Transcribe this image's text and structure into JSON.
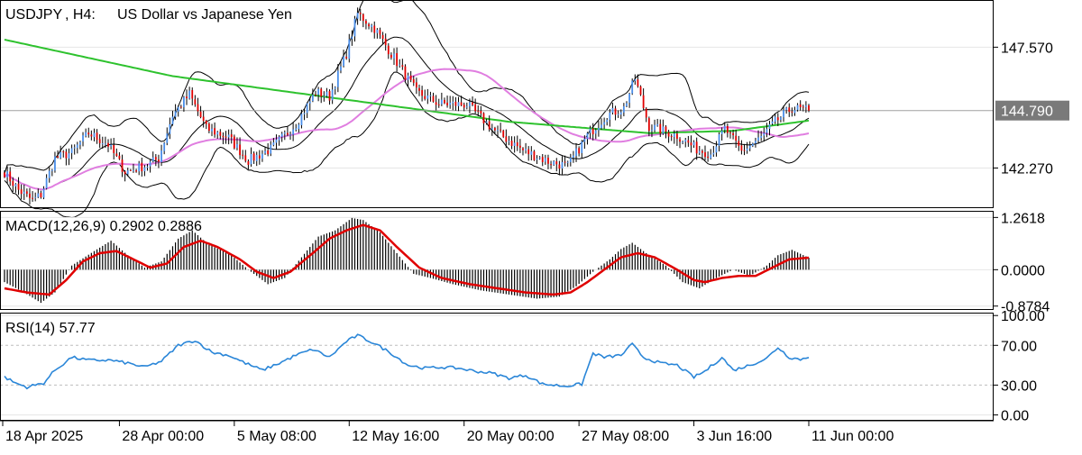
{
  "window": {
    "symbol": "USDJPY",
    "timeframe": "H4",
    "description": "US Dollar vs Japanese Yen"
  },
  "colors": {
    "background": "#ffffff",
    "grid": "#e6e6e6",
    "bull_candle": "#4b8ee8",
    "bear_candle": "#e00000",
    "bollinger": "#000000",
    "ma_fast": "#e07ee0",
    "ma_slow": "#2ec22e",
    "macd_histogram": "#000000",
    "macd_signal": "#e00000",
    "rsi_line": "#2a86d8",
    "price_line": "#a0a0a0",
    "current_price_label_bg": "#7a7a7a"
  },
  "chart_data": [
    {
      "type": "candlestick",
      "panel": "price",
      "title": "USDJPY, H4:  US Dollar vs Japanese Yen",
      "current_price": 144.79,
      "current_price_label": "144.790",
      "y_ticks": [
        {
          "value": 147.57,
          "label": "147.570"
        },
        {
          "value": 142.27,
          "label": "142.270"
        }
      ],
      "ylim": [
        140.55,
        149.6
      ],
      "x_ticks": [
        "18 Apr 2025",
        "28 Apr 00:00",
        "5 May 08:00",
        "12 May 16:00",
        "20 May 00:00",
        "27 May 08:00",
        "3 Jun 16:00",
        "11 Jun 00:00"
      ],
      "overlays": [
        "Bollinger Bands",
        "Moving Average (magenta)",
        "Moving Average (green)"
      ],
      "close_anchors": [
        [
          0,
          142.1
        ],
        [
          5,
          141.3
        ],
        [
          10,
          140.85
        ],
        [
          13,
          141.1
        ],
        [
          18,
          142.7
        ],
        [
          24,
          142.95
        ],
        [
          30,
          143.8
        ],
        [
          37,
          143.3
        ],
        [
          43,
          142.1
        ],
        [
          51,
          142.4
        ],
        [
          55,
          142.7
        ],
        [
          60,
          144.6
        ],
        [
          66,
          145.5
        ],
        [
          72,
          144.0
        ],
        [
          80,
          143.6
        ],
        [
          87,
          142.6
        ],
        [
          95,
          143.1
        ],
        [
          104,
          144.2
        ],
        [
          111,
          145.6
        ],
        [
          116,
          145.4
        ],
        [
          122,
          147.3
        ],
        [
          126,
          149.05
        ],
        [
          132,
          148.4
        ],
        [
          139,
          147.1
        ],
        [
          147,
          145.6
        ],
        [
          155,
          145.1
        ],
        [
          165,
          145.05
        ],
        [
          175,
          143.9
        ],
        [
          185,
          143.05
        ],
        [
          194,
          142.55
        ],
        [
          201,
          142.35
        ],
        [
          208,
          143.7
        ],
        [
          215,
          144.6
        ],
        [
          221,
          144.9
        ],
        [
          225,
          146.2
        ],
        [
          230,
          144.1
        ],
        [
          240,
          143.7
        ],
        [
          247,
          143.1
        ],
        [
          252,
          142.9
        ],
        [
          257,
          144.0
        ],
        [
          263,
          143.0
        ],
        [
          270,
          143.6
        ],
        [
          275,
          144.3
        ],
        [
          281,
          144.9
        ],
        [
          287,
          144.79
        ]
      ]
    },
    {
      "type": "line",
      "panel": "macd",
      "title": "MACD(12,26,9) 0.2902 0.2886",
      "series": [
        {
          "name": "MACD",
          "style": "histogram",
          "anchors": [
            [
              0,
              -0.3
            ],
            [
              7,
              -0.55
            ],
            [
              13,
              -0.8
            ],
            [
              18,
              -0.55
            ],
            [
              24,
              0.1
            ],
            [
              32,
              0.45
            ],
            [
              38,
              0.7
            ],
            [
              44,
              0.35
            ],
            [
              50,
              0.05
            ],
            [
              56,
              0.2
            ],
            [
              62,
              0.75
            ],
            [
              67,
              0.95
            ],
            [
              73,
              0.6
            ],
            [
              80,
              0.4
            ],
            [
              88,
              -0.05
            ],
            [
              94,
              -0.35
            ],
            [
              100,
              -0.2
            ],
            [
              106,
              0.3
            ],
            [
              112,
              0.8
            ],
            [
              118,
              0.95
            ],
            [
              124,
              1.25
            ],
            [
              128,
              1.2
            ],
            [
              134,
              0.9
            ],
            [
              140,
              0.4
            ],
            [
              146,
              -0.1
            ],
            [
              152,
              -0.2
            ],
            [
              160,
              -0.35
            ],
            [
              170,
              -0.5
            ],
            [
              180,
              -0.6
            ],
            [
              190,
              -0.7
            ],
            [
              198,
              -0.65
            ],
            [
              204,
              -0.4
            ],
            [
              210,
              -0.05
            ],
            [
              216,
              0.25
            ],
            [
              220,
              0.5
            ],
            [
              224,
              0.65
            ],
            [
              230,
              0.35
            ],
            [
              236,
              0.1
            ],
            [
              242,
              -0.3
            ],
            [
              248,
              -0.45
            ],
            [
              254,
              -0.2
            ],
            [
              260,
              0.0
            ],
            [
              266,
              -0.15
            ],
            [
              272,
              0.1
            ],
            [
              276,
              0.35
            ],
            [
              281,
              0.48
            ],
            [
              287,
              0.29
            ]
          ]
        },
        {
          "name": "Signal",
          "style": "line",
          "anchors": [
            [
              0,
              -0.45
            ],
            [
              8,
              -0.55
            ],
            [
              16,
              -0.6
            ],
            [
              22,
              -0.25
            ],
            [
              28,
              0.2
            ],
            [
              34,
              0.4
            ],
            [
              40,
              0.45
            ],
            [
              46,
              0.25
            ],
            [
              52,
              0.05
            ],
            [
              58,
              0.15
            ],
            [
              64,
              0.55
            ],
            [
              70,
              0.7
            ],
            [
              76,
              0.55
            ],
            [
              84,
              0.25
            ],
            [
              90,
              -0.05
            ],
            [
              96,
              -0.2
            ],
            [
              102,
              -0.05
            ],
            [
              110,
              0.4
            ],
            [
              116,
              0.75
            ],
            [
              122,
              0.95
            ],
            [
              128,
              1.08
            ],
            [
              134,
              0.95
            ],
            [
              140,
              0.55
            ],
            [
              148,
              0.05
            ],
            [
              156,
              -0.2
            ],
            [
              166,
              -0.35
            ],
            [
              176,
              -0.45
            ],
            [
              186,
              -0.55
            ],
            [
              196,
              -0.6
            ],
            [
              202,
              -0.55
            ],
            [
              208,
              -0.3
            ],
            [
              214,
              0.0
            ],
            [
              220,
              0.3
            ],
            [
              226,
              0.4
            ],
            [
              232,
              0.3
            ],
            [
              240,
              0.0
            ],
            [
              246,
              -0.25
            ],
            [
              250,
              -0.3
            ],
            [
              256,
              -0.2
            ],
            [
              262,
              -0.15
            ],
            [
              268,
              -0.15
            ],
            [
              274,
              0.05
            ],
            [
              280,
              0.25
            ],
            [
              287,
              0.29
            ]
          ]
        }
      ],
      "y_ticks": [
        {
          "value": 1.2618,
          "label": "1.2618"
        },
        {
          "value": 0.0,
          "label": "0.0000"
        },
        {
          "value": -0.8784,
          "label": "-0.8784"
        }
      ],
      "ylim": [
        -0.95,
        1.4
      ]
    },
    {
      "type": "line",
      "panel": "rsi",
      "title": "RSI(14) 57.77",
      "series": [
        {
          "name": "RSI(14)",
          "anchors": [
            [
              0,
              38
            ],
            [
              4,
              32
            ],
            [
              8,
              28
            ],
            [
              14,
              32
            ],
            [
              18,
              45
            ],
            [
              24,
              58
            ],
            [
              30,
              55
            ],
            [
              38,
              55
            ],
            [
              44,
              52
            ],
            [
              50,
              48
            ],
            [
              56,
              54
            ],
            [
              62,
              70
            ],
            [
              68,
              75
            ],
            [
              74,
              63
            ],
            [
              80,
              60
            ],
            [
              86,
              52
            ],
            [
              92,
              45
            ],
            [
              98,
              52
            ],
            [
              104,
              60
            ],
            [
              110,
              66
            ],
            [
              116,
              58
            ],
            [
              122,
              74
            ],
            [
              126,
              80
            ],
            [
              132,
              72
            ],
            [
              138,
              62
            ],
            [
              144,
              50
            ],
            [
              150,
              47
            ],
            [
              156,
              48
            ],
            [
              162,
              47
            ],
            [
              168,
              44
            ],
            [
              174,
              42
            ],
            [
              180,
              37
            ],
            [
              186,
              40
            ],
            [
              192,
              31
            ],
            [
              200,
              29
            ],
            [
              206,
              31
            ],
            [
              210,
              62
            ],
            [
              214,
              58
            ],
            [
              220,
              60
            ],
            [
              224,
              71
            ],
            [
              228,
              58
            ],
            [
              234,
              52
            ],
            [
              240,
              50
            ],
            [
              246,
              38
            ],
            [
              250,
              44
            ],
            [
              256,
              58
            ],
            [
              260,
              45
            ],
            [
              266,
              50
            ],
            [
              272,
              57
            ],
            [
              276,
              68
            ],
            [
              280,
              58
            ],
            [
              284,
              56
            ],
            [
              287,
              57.77
            ]
          ]
        }
      ],
      "y_ticks": [
        {
          "value": 100,
          "label": "100.00"
        },
        {
          "value": 70,
          "label": "70.00"
        },
        {
          "value": 30,
          "label": "30.00"
        },
        {
          "value": 0,
          "label": "0.00"
        }
      ],
      "ylim": [
        -5,
        102
      ]
    }
  ]
}
